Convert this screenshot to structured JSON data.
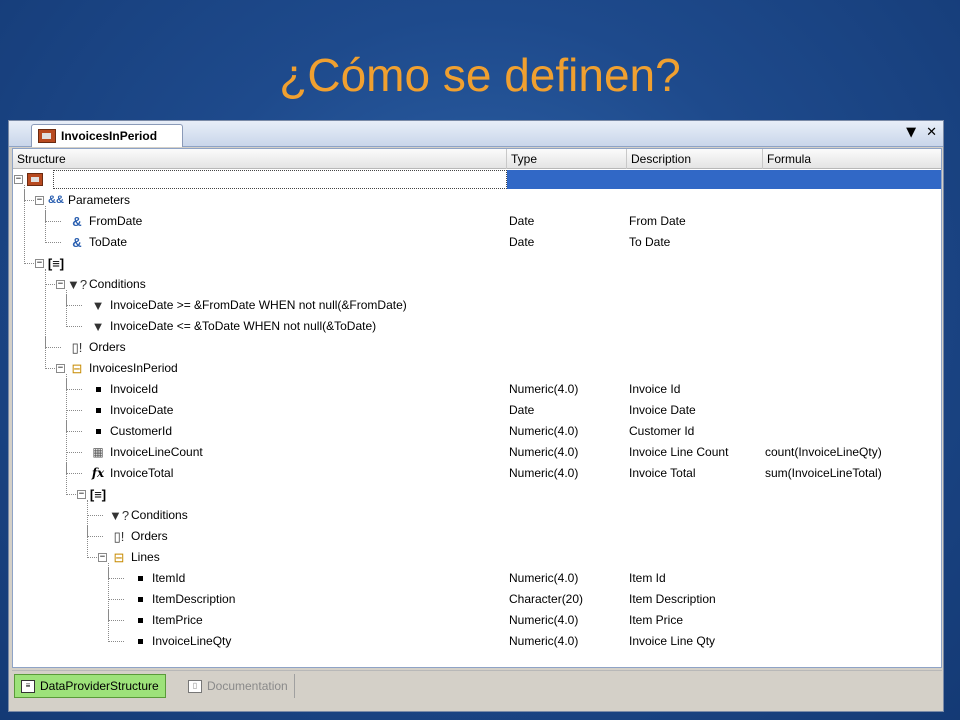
{
  "slide": {
    "title": "¿Cómo se definen?"
  },
  "window": {
    "tab_label": "InvoicesInPeriod",
    "dropdown_glyph": "▼",
    "close_glyph": "✕"
  },
  "columns": {
    "structure": "Structure",
    "type": "Type",
    "description": "Description",
    "formula": "Formula"
  },
  "rows": [
    {
      "depth": 0,
      "expander": "−",
      "icon": "root-icon",
      "label": "",
      "type": "",
      "description": "",
      "formula": "",
      "selected": true
    },
    {
      "depth": 1,
      "expander": "−",
      "icon": "parameters-icon",
      "label": "Parameters",
      "type": "",
      "description": "",
      "formula": ""
    },
    {
      "depth": 2,
      "expander": "",
      "icon": "parameter-icon",
      "label": "FromDate",
      "type": "Date",
      "description": "From Date",
      "formula": ""
    },
    {
      "depth": 2,
      "expander": "",
      "icon": "parameter-icon",
      "label": "ToDate",
      "type": "Date",
      "description": "To Date",
      "formula": ""
    },
    {
      "depth": 1,
      "expander": "−",
      "icon": "subgroup-icon",
      "label": "",
      "type": "",
      "description": "",
      "formula": ""
    },
    {
      "depth": 2,
      "expander": "−",
      "icon": "conditions-icon",
      "label": "Conditions",
      "type": "",
      "description": "",
      "formula": ""
    },
    {
      "depth": 3,
      "expander": "",
      "icon": "filter-icon",
      "label": "InvoiceDate >= &FromDate WHEN not null(&FromDate)",
      "type": "",
      "description": "",
      "formula": ""
    },
    {
      "depth": 3,
      "expander": "",
      "icon": "filter-icon",
      "label": "InvoiceDate <= &ToDate WHEN not null(&ToDate)",
      "type": "",
      "description": "",
      "formula": ""
    },
    {
      "depth": 2,
      "expander": "",
      "icon": "orders-icon",
      "label": "Orders",
      "type": "",
      "description": "",
      "formula": ""
    },
    {
      "depth": 2,
      "expander": "−",
      "icon": "group-icon",
      "label": "InvoicesInPeriod",
      "type": "",
      "description": "",
      "formula": ""
    },
    {
      "depth": 3,
      "expander": "",
      "icon": "element-icon",
      "label": "InvoiceId",
      "type": "Numeric(4.0)",
      "description": "Invoice Id",
      "formula": ""
    },
    {
      "depth": 3,
      "expander": "",
      "icon": "element-icon",
      "label": "InvoiceDate",
      "type": "Date",
      "description": "Invoice Date",
      "formula": ""
    },
    {
      "depth": 3,
      "expander": "",
      "icon": "element-icon",
      "label": "CustomerId",
      "type": "Numeric(4.0)",
      "description": "Customer Id",
      "formula": ""
    },
    {
      "depth": 3,
      "expander": "",
      "icon": "count-icon",
      "label": "InvoiceLineCount",
      "type": "Numeric(4.0)",
      "description": "Invoice Line Count",
      "formula": "count(InvoiceLineQty)"
    },
    {
      "depth": 3,
      "expander": "",
      "icon": "formula-icon",
      "label": "InvoiceTotal",
      "type": "Numeric(4.0)",
      "description": "Invoice Total",
      "formula": "sum(InvoiceLineTotal)"
    },
    {
      "depth": 3,
      "expander": "−",
      "icon": "subgroup-icon",
      "label": "",
      "type": "",
      "description": "",
      "formula": ""
    },
    {
      "depth": 4,
      "expander": "",
      "icon": "conditions-icon",
      "label": "Conditions",
      "type": "",
      "description": "",
      "formula": ""
    },
    {
      "depth": 4,
      "expander": "",
      "icon": "orders-icon",
      "label": "Orders",
      "type": "",
      "description": "",
      "formula": ""
    },
    {
      "depth": 4,
      "expander": "−",
      "icon": "group-icon",
      "label": "Lines",
      "type": "",
      "description": "",
      "formula": ""
    },
    {
      "depth": 5,
      "expander": "",
      "icon": "element-icon",
      "label": "ItemId",
      "type": "Numeric(4.0)",
      "description": "Item Id",
      "formula": ""
    },
    {
      "depth": 5,
      "expander": "",
      "icon": "element-icon",
      "label": "ItemDescription",
      "type": "Character(20)",
      "description": "Item Description",
      "formula": ""
    },
    {
      "depth": 5,
      "expander": "",
      "icon": "element-icon",
      "label": "ItemPrice",
      "type": "Numeric(4.0)",
      "description": "Item Price",
      "formula": ""
    },
    {
      "depth": 5,
      "expander": "",
      "icon": "element-icon",
      "label": "InvoiceLineQty",
      "type": "Numeric(4.0)",
      "description": "Invoice Line Qty",
      "formula": ""
    }
  ],
  "bottom_tabs": [
    {
      "label": "DataProviderStructure",
      "active": true
    },
    {
      "label": "Documentation",
      "active": false
    }
  ]
}
